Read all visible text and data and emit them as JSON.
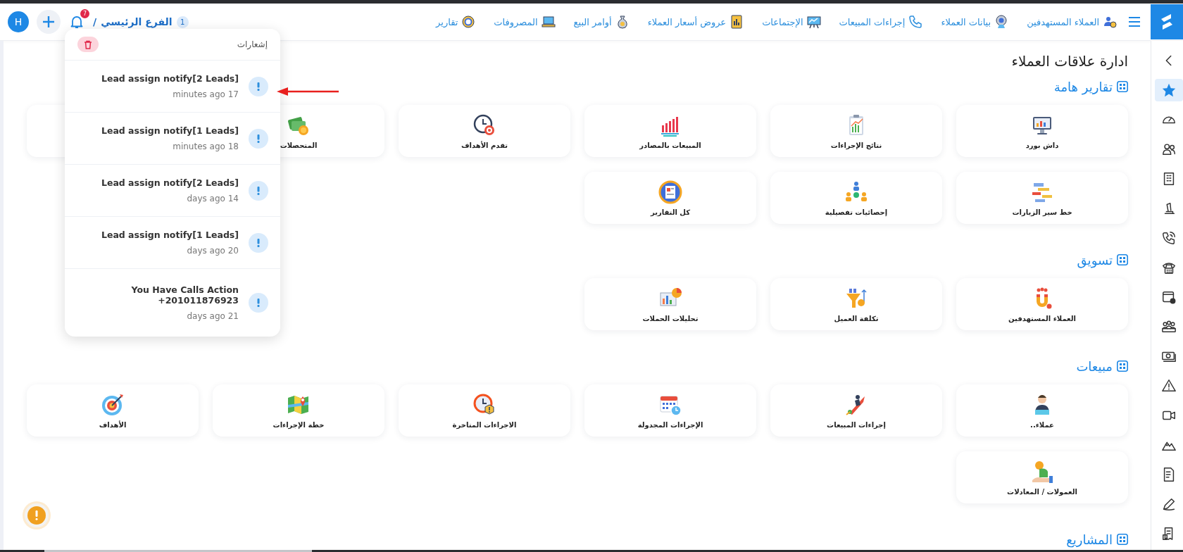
{
  "topbar": {
    "avatar": "H",
    "notifications_badge": "7",
    "branch": {
      "count": "1",
      "name": "الفرع الرئيسي",
      "separator": "/"
    },
    "nav": [
      "العملاء المستهدفين",
      "بيانات العملاء",
      "إجراءات المبيعات",
      "الإجتماعات",
      "عروض أسعار العملاء",
      "أوامر البيع",
      "المصروفات",
      "تقارير"
    ]
  },
  "sidebar": {
    "items": [
      {
        "selected": true
      },
      {
        "selected": false
      },
      {
        "selected": false
      },
      {
        "selected": false
      },
      {
        "selected": false
      },
      {
        "selected": false
      },
      {
        "selected": false
      },
      {
        "selected": false
      },
      {
        "selected": false
      },
      {
        "selected": false
      },
      {
        "selected": false
      },
      {
        "selected": false
      },
      {
        "selected": false
      },
      {
        "selected": false
      },
      {
        "selected": false
      },
      {
        "selected": false
      }
    ]
  },
  "page_title": "ادارة علاقات العملاء",
  "sections": [
    {
      "title": "تقارير هامة",
      "cards": [
        {
          "kind": "tile",
          "label": "داش بورد"
        },
        {
          "kind": "tile",
          "label": "نتائج الإجراءات"
        },
        {
          "kind": "tile",
          "label": "المبيعات بالمصادر"
        },
        {
          "kind": "tile",
          "label": "تقدم الأهداف"
        },
        {
          "kind": "tile",
          "label": "المتحصلات"
        },
        {
          "kind": "covered"
        },
        {
          "kind": "tile",
          "label": "خط سير الزيارات"
        },
        {
          "kind": "tile",
          "label": "إحصائيات تفصيلية"
        },
        {
          "kind": "tile",
          "label": "كل التقارير"
        }
      ]
    },
    {
      "title": "تسويق",
      "cards": [
        {
          "kind": "tile",
          "label": "العملاء المستهدفين"
        },
        {
          "kind": "tile",
          "label": "تكلفة العميل"
        },
        {
          "kind": "tile",
          "label": "تحليلات الحملات"
        }
      ]
    },
    {
      "title": "مبيعات",
      "cards": [
        {
          "kind": "tile",
          "label": "عملاء.."
        },
        {
          "kind": "tile",
          "label": "إجراءات المبيعات"
        },
        {
          "kind": "tile",
          "label": "الإجراءات المجدولة"
        },
        {
          "kind": "tile",
          "label": "الاجراءات المتاخرة"
        },
        {
          "kind": "tile",
          "label": "خطة الإجراءات"
        },
        {
          "kind": "tile",
          "label": "الأهداف"
        },
        {
          "kind": "tile",
          "label": "العمولات / المعادلات"
        }
      ]
    },
    {
      "title": "المشاريع"
    }
  ],
  "notifications": {
    "title": "إشعارات",
    "items": [
      {
        "title": "Lead assign notify[2 Leads]",
        "time": "minutes ago 17"
      },
      {
        "title": "Lead assign notify[1 Leads]",
        "time": "minutes ago 18"
      },
      {
        "title": "Lead assign notify[2 Leads]",
        "time": "days ago 14"
      },
      {
        "title": "Lead assign notify[1 Leads]",
        "time": "days ago 20"
      },
      {
        "title": "You Have Calls Action\n+201011876923",
        "time": "days ago 21"
      }
    ]
  }
}
